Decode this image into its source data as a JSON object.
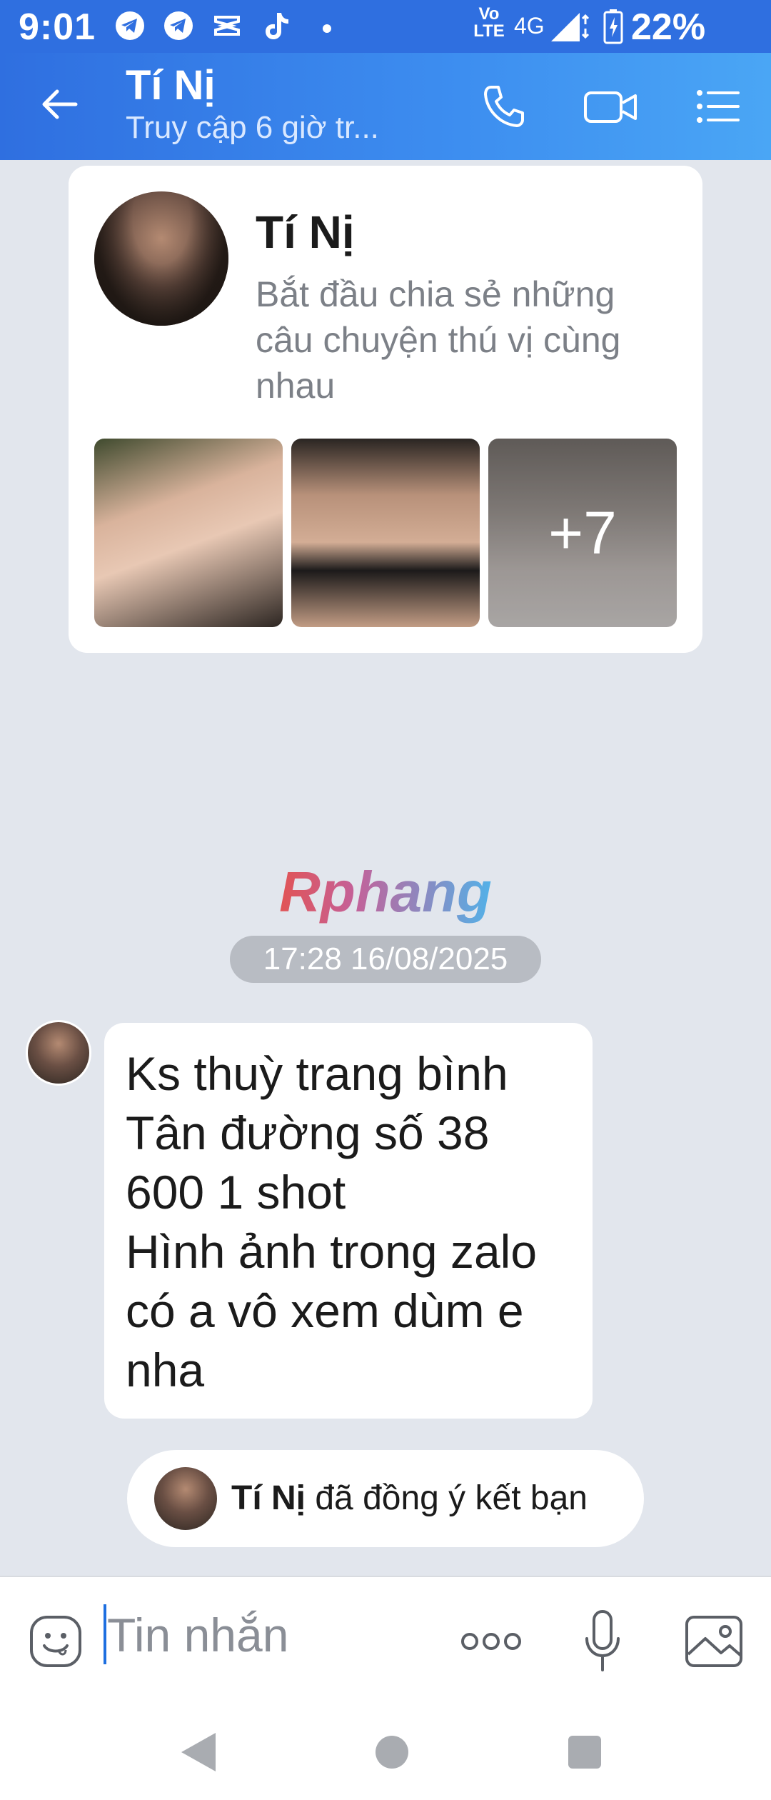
{
  "status_bar": {
    "time": "9:01",
    "volte_label": "Vo LTE",
    "network": "4G",
    "battery_percent": "22%",
    "notification_icons": [
      "telegram-icon",
      "telegram-icon",
      "capcut-icon",
      "tiktok-icon",
      "dot-icon"
    ]
  },
  "header": {
    "title": "Tí Nị",
    "subtitle": "Truy cập 6 giờ tr...",
    "icons": [
      "back-arrow-icon",
      "phone-icon",
      "video-call-icon",
      "menu-list-icon"
    ]
  },
  "profile_card": {
    "name": "Tí Nị",
    "bio": "Bắt đầu chia sẻ những câu chuyện thú vị cùng nhau",
    "more_photos": "+7"
  },
  "watermark": "Rphang",
  "timestamp": "17:28 16/08/2025",
  "message": {
    "lines": [
      "Ks thuỳ trang bình",
      "Tân đường số 38",
      "600 1 shot",
      "Hình ảnh trong zalo",
      "có a vô xem dùm e",
      "nha"
    ]
  },
  "friend_notice": {
    "name": "Tí Nị",
    "text": " đã đồng ý kết bạn"
  },
  "composer": {
    "placeholder": "Tin nhắn",
    "icons": [
      "emoji-icon",
      "more-dots-icon",
      "microphone-icon",
      "image-icon"
    ]
  },
  "colors": {
    "header_start": "#2f6fe0",
    "header_end": "#4aa6f5",
    "background": "#e2e6ed",
    "timestamp_bg": "#b8bcc3",
    "caret": "#1e6fe0"
  }
}
